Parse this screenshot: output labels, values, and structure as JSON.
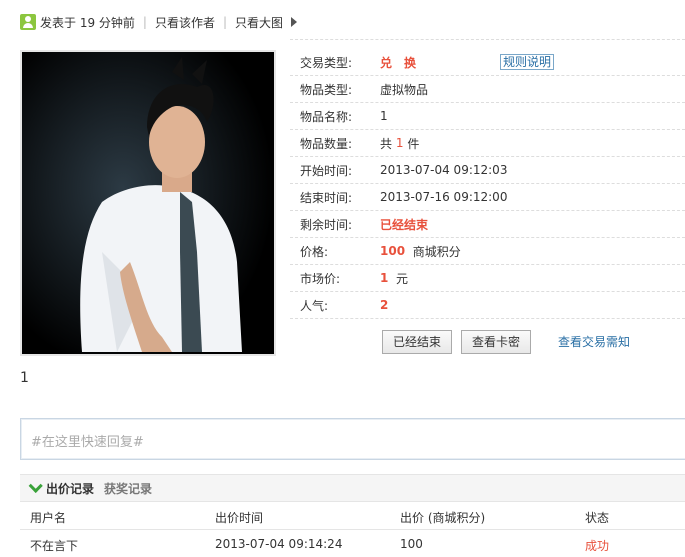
{
  "toolbar": {
    "posted": "发表于 19 分钟前",
    "only_author": "只看该作者",
    "only_big_image": "只看大图"
  },
  "info": {
    "rows": [
      {
        "label": "交易类型:",
        "value": "兑　换"
      },
      {
        "label": "物品类型:",
        "value": "虚拟物品"
      },
      {
        "label": "物品名称:",
        "value": "1"
      },
      {
        "label": "物品数量:",
        "prefix": "共",
        "num": "1",
        "suffix": "件"
      },
      {
        "label": "开始时间:",
        "value": "2013-07-04 09:12:03"
      },
      {
        "label": "结束时间:",
        "value": "2013-07-16 09:12:00"
      },
      {
        "label": "剩余时间:",
        "value": "已经结束"
      },
      {
        "label": "价格:",
        "num": "100",
        "suffix": "商城积分"
      },
      {
        "label": "市场价:",
        "num": "1",
        "suffix": "元"
      },
      {
        "label": "人气:",
        "value": "2"
      }
    ],
    "rules_label": "规则说明"
  },
  "buttons": {
    "ended": "已经结束",
    "view_card": "查看卡密",
    "trade_info": "查看交易需知"
  },
  "content_text": "1",
  "reply": {
    "placeholder": "#在这里快速回复#"
  },
  "tabs": {
    "bids": "出价记录",
    "awards": "获奖记录"
  },
  "table": {
    "headers": [
      "用户名",
      "出价时间",
      "出价 (商城积分)",
      "状态"
    ],
    "rows": [
      [
        "不在言下",
        "2013-07-04 09:14:24",
        "100",
        "成功"
      ]
    ]
  },
  "colors": {
    "accent_red": "#e8513c",
    "link_blue": "#2a6fa5",
    "icon_green": "#8cc63f"
  }
}
